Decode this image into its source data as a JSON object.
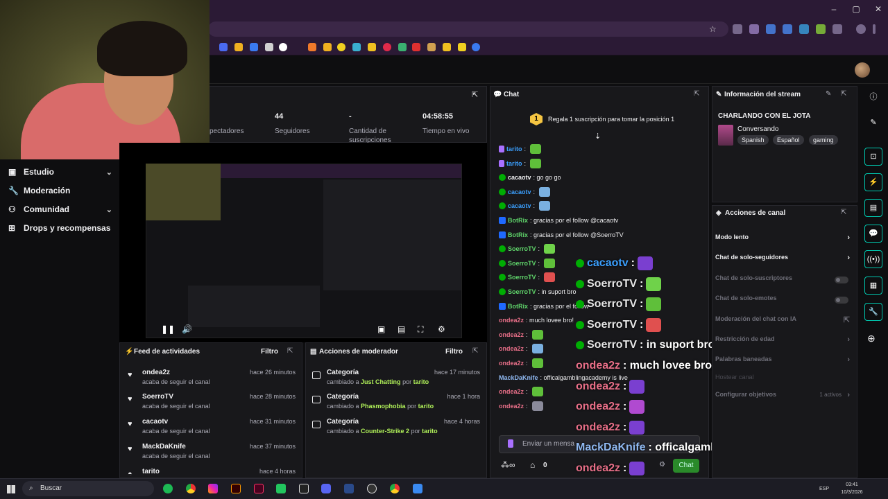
{
  "browser": {
    "window_controls": [
      "–",
      "▢",
      "✕"
    ]
  },
  "sidebar": {
    "items": [
      {
        "label": "Estudio",
        "icon": "studio-icon",
        "expandable": true
      },
      {
        "label": "Moderación",
        "icon": "wrench-icon",
        "expandable": false
      },
      {
        "label": "Comunidad",
        "icon": "people-icon",
        "expandable": true
      },
      {
        "label": "Drops y recompensas",
        "icon": "gift-icon",
        "expandable": false
      }
    ]
  },
  "stats": {
    "spectators_label": "pectadores",
    "followers_value": "44",
    "followers_label": "Seguidores",
    "subs_value": "-",
    "subs_label_1": "Cantidad de",
    "subs_label_2": "suscripciones",
    "live_value": "04:58:55",
    "live_label": "Tiempo en vivo"
  },
  "feed": {
    "title": "Feed de actividades",
    "filter": "Filtro",
    "items": [
      {
        "name": "ondea2z",
        "sub": "acaba de seguir el canal",
        "time": "hace 26 minutos"
      },
      {
        "name": "SoerroTV",
        "sub": "acaba de seguir el canal",
        "time": "hace 28 minutos"
      },
      {
        "name": "cacaotv",
        "sub": "acaba de seguir el canal",
        "time": "hace 31 minutos"
      },
      {
        "name": "MackDaKnife",
        "sub": "acaba de seguir el canal",
        "time": "hace 37 minutos"
      },
      {
        "name": "tarito",
        "sub": "",
        "time": "hace 4 horas"
      }
    ]
  },
  "mod_actions": {
    "title": "Acciones de moderador",
    "filter": "Filtro",
    "items": [
      {
        "name": "Categoría",
        "prefix": "cambiado a",
        "category": "Just Chatting",
        "by": "por",
        "user": "tarito",
        "time": "hace 17 minutos"
      },
      {
        "name": "Categoría",
        "prefix": "cambiado a",
        "category": "Phasmophobia",
        "by": "por",
        "user": "tarito",
        "time": "hace 1 hora"
      },
      {
        "name": "Categoría",
        "prefix": "cambiado a",
        "category": "Counter-Strike 2",
        "by": "por",
        "user": "tarito",
        "time": "hace 4 horas"
      }
    ]
  },
  "chat": {
    "title": "Chat",
    "gift_badge": "1",
    "gift_text": "Regala 1 suscripción para tomar la posición 1",
    "input_placeholder": "Enviar un mensa",
    "points": "0",
    "send_label": "Chat",
    "lines": [
      {
        "user": "tarito",
        "color": "#3ba0ff",
        "badge": "mic",
        "text": "",
        "emote": "#5fbf3a"
      },
      {
        "user": "tarito",
        "color": "#3ba0ff",
        "badge": "mic",
        "text": "",
        "emote": "#5fbf3a"
      },
      {
        "user": "cacaotv",
        "color": "#efeff1",
        "badge": "mod",
        "text": ": go go go",
        "emote": ""
      },
      {
        "user": "cacaotv",
        "color": "#3ba0ff",
        "badge": "mod",
        "text": "",
        "emote": "#7ab0e0"
      },
      {
        "user": "cacaotv",
        "color": "#3ba0ff",
        "badge": "mod",
        "text": "",
        "emote": "#7ab0e0"
      },
      {
        "user": "BotRix",
        "color": "#5fd36a",
        "badge": "bot",
        "text": ": gracias por el follow @cacaotv",
        "emote": ""
      },
      {
        "user": "BotRix",
        "color": "#5fd36a",
        "badge": "bot",
        "text": ": gracias por el follow @SoerroTV",
        "emote": ""
      },
      {
        "user": "SoerroTV",
        "color": "#5fd36a",
        "badge": "mod",
        "text": "",
        "emote": "#6fd24a"
      },
      {
        "user": "SoerroTV",
        "color": "#5fd36a",
        "badge": "mod",
        "text": "",
        "emote": "#5fbf3a"
      },
      {
        "user": "SoerroTV",
        "color": "#5fd36a",
        "badge": "mod",
        "text": "",
        "emote": "#e0504f"
      },
      {
        "user": "SoerroTV",
        "color": "#5fd36a",
        "badge": "mod",
        "text": ": in suport bro",
        "emote": ""
      },
      {
        "user": "BotRix",
        "color": "#5fd36a",
        "badge": "bot",
        "text": ": gracias por el follow",
        "emote": ""
      },
      {
        "user": "ondea2z",
        "color": "#e86f88",
        "badge": "",
        "text": ": much lovee bro!",
        "emote": ""
      },
      {
        "user": "ondea2z",
        "color": "#e86f88",
        "badge": "",
        "text": "",
        "emote": "#5fbf3a"
      },
      {
        "user": "ondea2z",
        "color": "#e86f88",
        "badge": "",
        "text": "",
        "emote": "#7ab0e0"
      },
      {
        "user": "ondea2z",
        "color": "#e86f88",
        "badge": "",
        "text": "",
        "emote": "#5fbf3a"
      },
      {
        "user": "MackDaKnife",
        "color": "#8fb8f0",
        "badge": "",
        "text": ": officalgamblingacademy is live",
        "emote": ""
      },
      {
        "user": "ondea2z",
        "color": "#e86f88",
        "badge": "",
        "text": "",
        "emote": "#5fbf3a"
      },
      {
        "user": "ondea2z",
        "color": "#e86f88",
        "badge": "",
        "text": "",
        "emote": "#8a8a9a"
      }
    ]
  },
  "overlay": {
    "lines": [
      {
        "user": "cacaotv",
        "color": "#3ba0ff",
        "badge": true,
        "text": ":",
        "emote": "#7a3fd0"
      },
      {
        "user": "SoerroTV",
        "color": "#e6e6e6",
        "badge": true,
        "text": ":",
        "emote": "#6fd24a"
      },
      {
        "user": "SoerroTV",
        "color": "#e6e6e6",
        "badge": true,
        "text": ":",
        "emote": "#5fbf3a"
      },
      {
        "user": "SoerroTV",
        "color": "#e6e6e6",
        "badge": true,
        "text": ":",
        "emote": "#e0504f"
      },
      {
        "user": "SoerroTV",
        "color": "#e6e6e6",
        "badge": true,
        "text": ": in suport bro",
        "emote": ""
      },
      {
        "user": "ondea2z",
        "color": "#e86f88",
        "badge": false,
        "text": ": much lovee bro!",
        "emote": ""
      },
      {
        "user": "ondea2z",
        "color": "#e86f88",
        "badge": false,
        "text": ":",
        "emote": "#7a3fd0"
      },
      {
        "user": "ondea2z",
        "color": "#e86f88",
        "badge": false,
        "text": ":",
        "emote": "#b04ad0"
      },
      {
        "user": "ondea2z",
        "color": "#e86f88",
        "badge": false,
        "text": ":",
        "emote": "#7a3fd0"
      },
      {
        "user": "MackDaKnife",
        "color": "#8fb8f0",
        "badge": false,
        "text": ": officalgamblingacademy is live",
        "emote": ""
      },
      {
        "user": "ondea2z",
        "color": "#e86f88",
        "badge": false,
        "text": ":",
        "emote": "#7a3fd0"
      },
      {
        "user": "ondea2z",
        "color": "#e86f88",
        "badge": false,
        "text": ":",
        "emote": "#8a8a9a"
      }
    ]
  },
  "stream_info": {
    "title": "Información del stream",
    "stream_title": "CHARLANDO CON EL JOTA",
    "category": "Conversando",
    "tags": [
      "Spanish",
      "Español",
      "gaming"
    ]
  },
  "channel_actions": {
    "title": "Acciones de canal",
    "items": [
      {
        "label": "Modo lento",
        "control": "arrow",
        "dim": false
      },
      {
        "label": "Chat de solo-seguidores",
        "control": "arrow",
        "dim": false
      },
      {
        "label": "Chat de solo-suscriptores",
        "control": "toggle",
        "dim": true
      },
      {
        "label": "Chat de solo-emotes",
        "control": "toggle",
        "dim": true
      },
      {
        "label": "Moderación del chat con IA",
        "control": "ext",
        "dim": true
      },
      {
        "label": "Restricción de edad",
        "control": "arrow",
        "dim": true
      },
      {
        "label": "Palabras baneadas",
        "control": "arrow",
        "dim": true
      },
      {
        "label": "Hostear canal",
        "control": "none",
        "dim": true
      },
      {
        "label": "Configurar objetivos",
        "control": "active",
        "dim": true
      }
    ],
    "active_label": "1 activos"
  },
  "taskbar": {
    "search_label": "Buscar",
    "lang": "ESP",
    "time": "03:41",
    "date": "10/3/2026"
  }
}
